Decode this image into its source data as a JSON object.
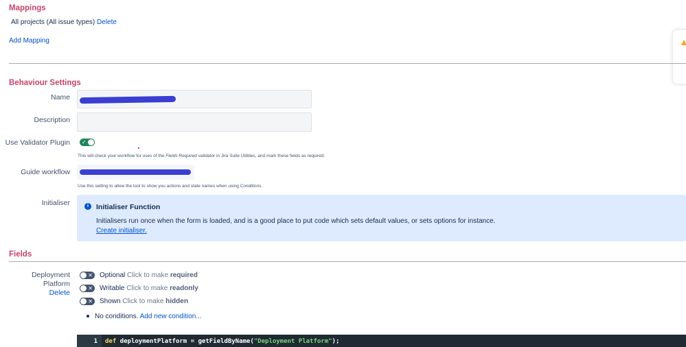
{
  "mappings": {
    "title": "Mappings",
    "entry_text": "All projects (All issue types)",
    "delete_label": "Delete",
    "add_label": "Add Mapping"
  },
  "behaviour": {
    "title": "Behaviour Settings",
    "name_label": "Name",
    "description_label": "Description",
    "validator_label": "Use Validator Plugin",
    "validator_help_pre": "This will check your workflow for uses of the ",
    "validator_help_em": "Fields Required",
    "validator_help_post": " validator in Jira Suite Utilities, and mark these fields as required.",
    "guide_label": "Guide workflow",
    "guide_help_pre": "Use this setting to allow the tool to show you actions and state names when using ",
    "guide_help_em": "Conditions",
    "guide_help_post": ".",
    "initialiser_label": "Initialiser",
    "init_title": "Initialiser Function",
    "init_body": "Initialisers run once when the form is loaded, and is a good place to put code which sets default values, or sets options for instance.",
    "init_link": "Create initialiser."
  },
  "fields": {
    "title": "Fields",
    "field_name_line1": "Deployment",
    "field_name_line2": "Platform",
    "field_delete": "Delete",
    "options": [
      {
        "state": "Optional",
        "hint": "Click to make",
        "target": "required"
      },
      {
        "state": "Writable",
        "hint": "Click to make",
        "target": "readonly"
      },
      {
        "state": "Shown",
        "hint": "Click to make",
        "target": "hidden"
      }
    ],
    "conditions_text": "No conditions.",
    "add_condition": "Add new condition..."
  },
  "code": {
    "line_number": "1",
    "keyword": "def",
    "statement": " deploymentPlatform = getFieldByName(",
    "string": "\"Deployment Platform\"",
    "end": ");"
  },
  "colors": {
    "section_title": "#c9436b",
    "link": "#0052cc",
    "toggle_on": "#1f845a",
    "info_bg": "#deebff",
    "redaction": "#3a3fd1"
  }
}
